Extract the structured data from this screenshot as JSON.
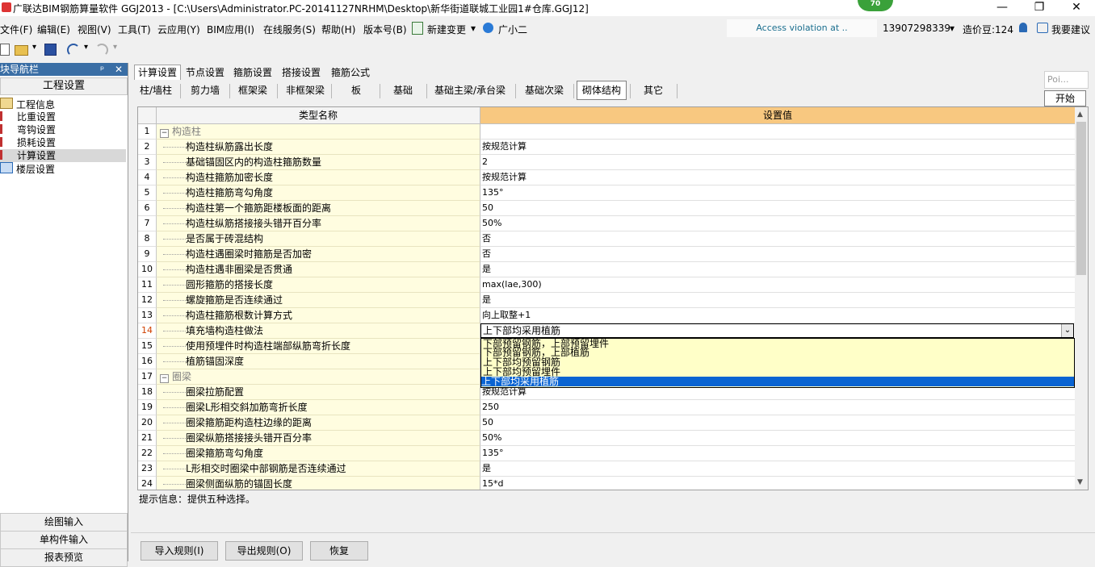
{
  "window": {
    "title": "广联达BIM钢筋算量软件 GGJ2013 - [C:\\Users\\Administrator.PC-20141127NRHM\\Desktop\\新华街道联城工业园1#仓库.GGJ12]",
    "badge": "70",
    "minimize": "—",
    "maximize": "❐",
    "close": "✕"
  },
  "menu": {
    "items": [
      "文件(F)",
      "编辑(E)",
      "视图(V)",
      "工具(T)",
      "云应用(Y)",
      "BIM应用(I)",
      "在线服务(S)",
      "帮助(H)",
      "版本号(B)"
    ],
    "new_change": "新建变更",
    "new_change_arrow": "▾",
    "assistant": "广小二",
    "access_message": "Access violation at ..",
    "phone": "13907298339",
    "phone_arrow": "▾",
    "credits": "造价豆:124",
    "feedback": "我要建议"
  },
  "toolbar": {
    "undo_arrow": "▾",
    "redo_arrow": "▾",
    "open_arrow": "▾"
  },
  "nav": {
    "header": "块导航栏",
    "pin": "ᵖ",
    "close": "✕",
    "title": "工程设置",
    "items": [
      "工程信息",
      "比重设置",
      "弯钩设置",
      "损耗设置",
      "计算设置",
      "楼层设置"
    ],
    "bottom": [
      "绘图输入",
      "单构件输入",
      "报表预览"
    ]
  },
  "main": {
    "tabs": [
      "计算设置",
      "节点设置",
      "箍筋设置",
      "搭接设置",
      "箍筋公式"
    ],
    "subtabs": [
      "柱/墙柱",
      "剪力墙",
      "框架梁",
      "非框架梁",
      "板",
      "基础",
      "基础主梁/承台梁",
      "基础次梁",
      "砌体结构",
      "其它"
    ],
    "grid": {
      "col_name": "类型名称",
      "col_value": "设置值",
      "rows": [
        {
          "num": "1",
          "name": "构造柱",
          "value": "",
          "category": true
        },
        {
          "num": "2",
          "name": "构造柱纵筋露出长度",
          "value": "按规范计算"
        },
        {
          "num": "3",
          "name": "基础锚固区内的构造柱箍筋数量",
          "value": "2"
        },
        {
          "num": "4",
          "name": "构造柱箍筋加密长度",
          "value": "按规范计算"
        },
        {
          "num": "5",
          "name": "构造柱箍筋弯勾角度",
          "value": "135°"
        },
        {
          "num": "6",
          "name": "构造柱第一个箍筋距楼板面的距离",
          "value": "50"
        },
        {
          "num": "7",
          "name": "构造柱纵筋搭接接头错开百分率",
          "value": "50%"
        },
        {
          "num": "8",
          "name": "是否属于砖混结构",
          "value": "否"
        },
        {
          "num": "9",
          "name": "构造柱遇圈梁时箍筋是否加密",
          "value": "否"
        },
        {
          "num": "10",
          "name": "构造柱遇非圈梁是否贯通",
          "value": "是"
        },
        {
          "num": "11",
          "name": "圆形箍筋的搭接长度",
          "value": "max(lae,300)"
        },
        {
          "num": "12",
          "name": "螺旋箍筋是否连续通过",
          "value": "是"
        },
        {
          "num": "13",
          "name": "构造柱箍筋根数计算方式",
          "value": "向上取整+1"
        },
        {
          "num": "14",
          "name": "填充墙构造柱做法",
          "value": "上下部均采用植筋",
          "active": true
        },
        {
          "num": "15",
          "name": "使用预埋件时构造柱端部纵筋弯折长度",
          "value": ""
        },
        {
          "num": "16",
          "name": "植筋锚固深度",
          "value": ""
        },
        {
          "num": "17",
          "name": "圈梁",
          "value": "",
          "category": true
        },
        {
          "num": "18",
          "name": "圈梁拉筋配置",
          "value": "按规范计算"
        },
        {
          "num": "19",
          "name": "圈梁L形相交斜加筋弯折长度",
          "value": "250"
        },
        {
          "num": "20",
          "name": "圈梁箍筋距构造柱边缘的距离",
          "value": "50"
        },
        {
          "num": "21",
          "name": "圈梁纵筋搭接接头错开百分率",
          "value": "50%"
        },
        {
          "num": "22",
          "name": "圈梁箍筋弯勾角度",
          "value": "135°"
        },
        {
          "num": "23",
          "name": "L形相交时圈梁中部钢筋是否连续通过",
          "value": "是"
        },
        {
          "num": "24",
          "name": "圈梁侧面纵筋的锚固长度",
          "value": "15*d"
        }
      ],
      "dropdown_options": [
        "下部预留钢筋，上部预留埋件",
        "下部预留钢筋，上部植筋",
        "上下部均预留钢筋",
        "上下部均预留埋件",
        "上下部均采用植筋"
      ],
      "selected_option": "上下部均采用植筋",
      "dropdown_arrow": "⌄"
    },
    "hint": "提示信息：提供五种选择。",
    "buttons": [
      "导入规则(I)",
      "导出规则(O)",
      "恢复"
    ]
  },
  "float": {
    "poi": "Poi...",
    "start": "开始"
  }
}
